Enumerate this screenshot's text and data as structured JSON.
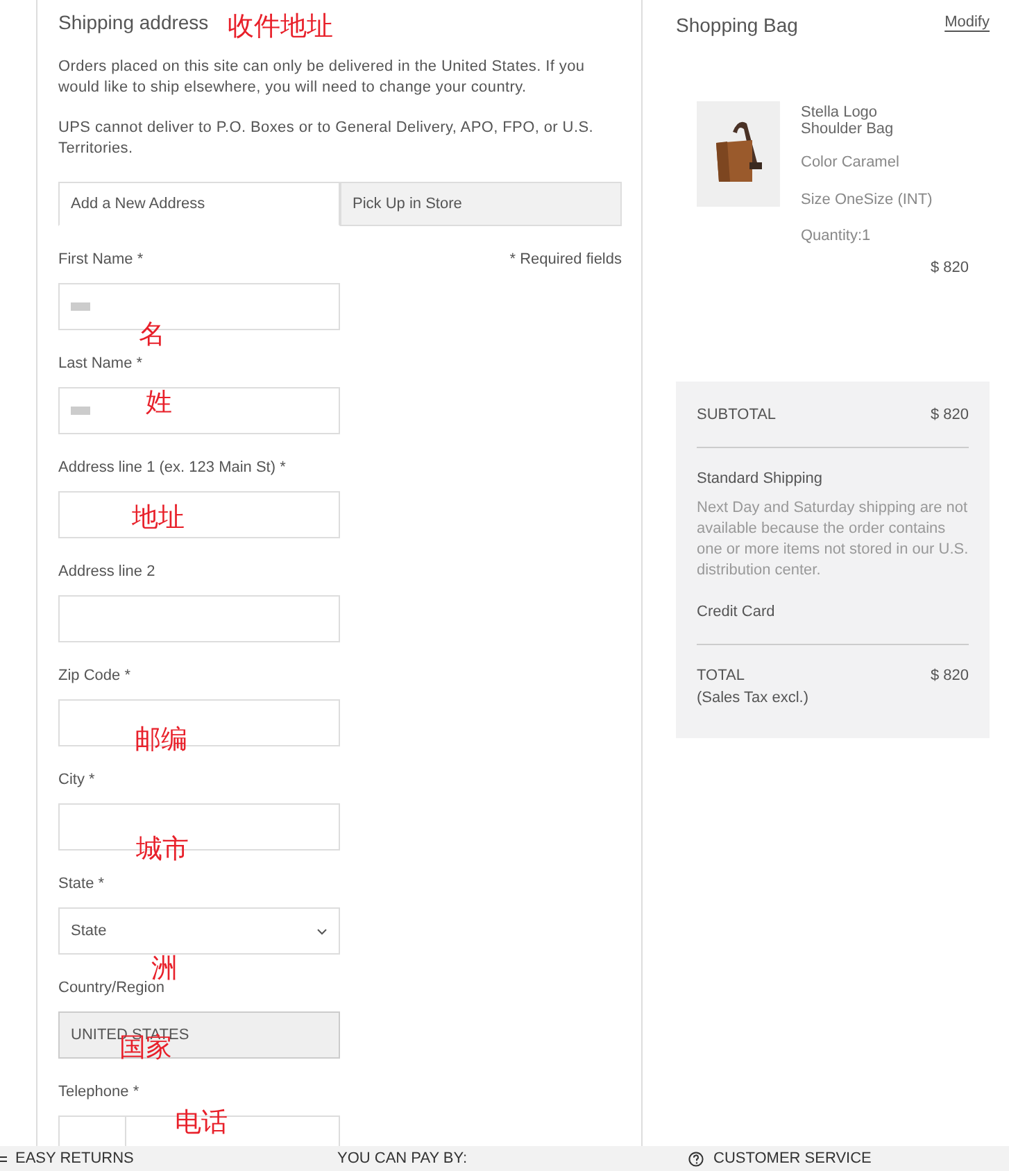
{
  "shipping": {
    "title": "Shipping address",
    "title_note": "收件地址",
    "notices": [
      "Orders placed on this site can only be delivered in the United States. If you would like to ship elsewhere, you will need to change your country.",
      "UPS cannot deliver to P.O. Boxes or to General Delivery, APO, FPO, or U.S. Territories."
    ],
    "tabs": [
      {
        "label": "Add a New Address",
        "selected": true
      },
      {
        "label": "Pick Up in Store",
        "selected": false
      }
    ],
    "required_note": "* Required fields",
    "fields": [
      {
        "kind": "text",
        "label": "First Name *",
        "redacted": true,
        "note": "名"
      },
      {
        "kind": "text",
        "label": "Last Name *",
        "redacted": true,
        "note": "姓"
      },
      {
        "kind": "text",
        "label": "Address line 1 (ex. 123 Main St) *",
        "redacted": false,
        "note": "地址"
      },
      {
        "kind": "text",
        "label": "Address line 2",
        "redacted": false
      },
      {
        "kind": "text",
        "label": "Zip Code *",
        "redacted": false,
        "note": "邮编"
      },
      {
        "kind": "text",
        "label": "City *",
        "redacted": false,
        "note": "城市"
      },
      {
        "kind": "select",
        "label": "State *",
        "value": "State",
        "note": "洲"
      },
      {
        "kind": "readonly",
        "label": "Country/Region",
        "value": "UNITED STATES",
        "note": "国家"
      },
      {
        "kind": "phone",
        "label": "Telephone *",
        "note": "电话"
      }
    ]
  },
  "bag": {
    "title": "Shopping Bag",
    "modify": "Modify",
    "item": {
      "name": "Stella Logo Shoulder Bag",
      "color_text": "Color Caramel",
      "size": "Size OneSize (INT)",
      "quantity": "Quantity:1",
      "price": "$ 820"
    },
    "summary": {
      "subtotal_label": "SUBTOTAL",
      "subtotal": "$ 820",
      "shipping_label": "Standard Shipping",
      "shipping_note": "Next Day and Saturday shipping are not available because the order contains one or more items not stored in our U.S. distribution center.",
      "payment": "Credit Card",
      "total_label": "TOTAL",
      "total_note": "(Sales Tax excl.)",
      "total": "$ 820"
    }
  },
  "footer": [
    "EASY RETURNS",
    "YOU CAN PAY BY:",
    "CUSTOMER SERVICE"
  ]
}
